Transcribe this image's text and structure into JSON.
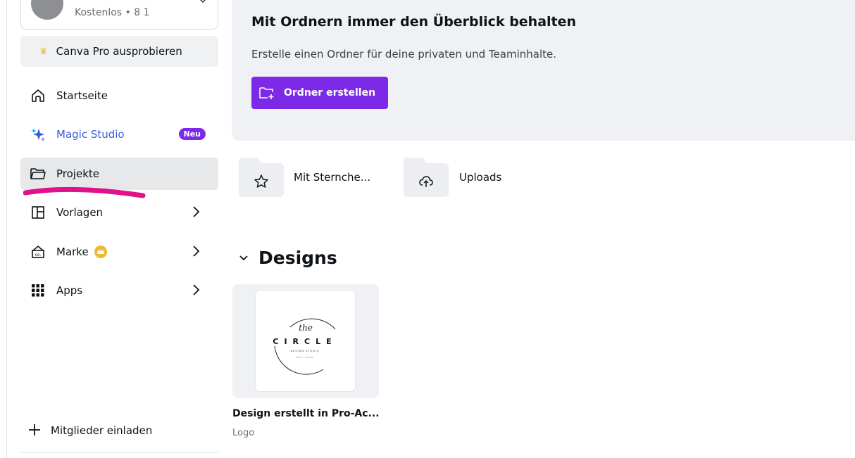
{
  "sidebar": {
    "account_sub": "Kostenlos • 8 1",
    "try_pro": "Canva Pro ausprobieren",
    "items": [
      {
        "label": "Startseite"
      },
      {
        "label": "Magic Studio",
        "badge": "Neu"
      },
      {
        "label": "Projekte"
      },
      {
        "label": "Vorlagen"
      },
      {
        "label": "Marke"
      },
      {
        "label": "Apps"
      }
    ],
    "invite": "Mitglieder einladen"
  },
  "banner": {
    "title": "Mit Ordnern immer den Überblick behalten",
    "subtitle": "Erstelle einen Ordner für deine privaten und Teaminhalte.",
    "button": "Ordner erstellen"
  },
  "folders": [
    {
      "label": "Mit Sternche...",
      "icon": "star-icon"
    },
    {
      "label": "Uploads",
      "icon": "cloud-upload-icon"
    }
  ],
  "designs": {
    "heading": "Designs",
    "items": [
      {
        "title": "Design erstellt in Pro-Ac...",
        "type": "Logo",
        "thumb": {
          "word": "CIRCLE",
          "the": "the",
          "line1": "DESIGN STUDIO",
          "line2": "EST. 2019"
        }
      }
    ]
  },
  "colors": {
    "accent": "#7d2ae8",
    "magic": "#3b5bdb",
    "highlight": "#e0128a",
    "crown": "#f0b82e"
  }
}
